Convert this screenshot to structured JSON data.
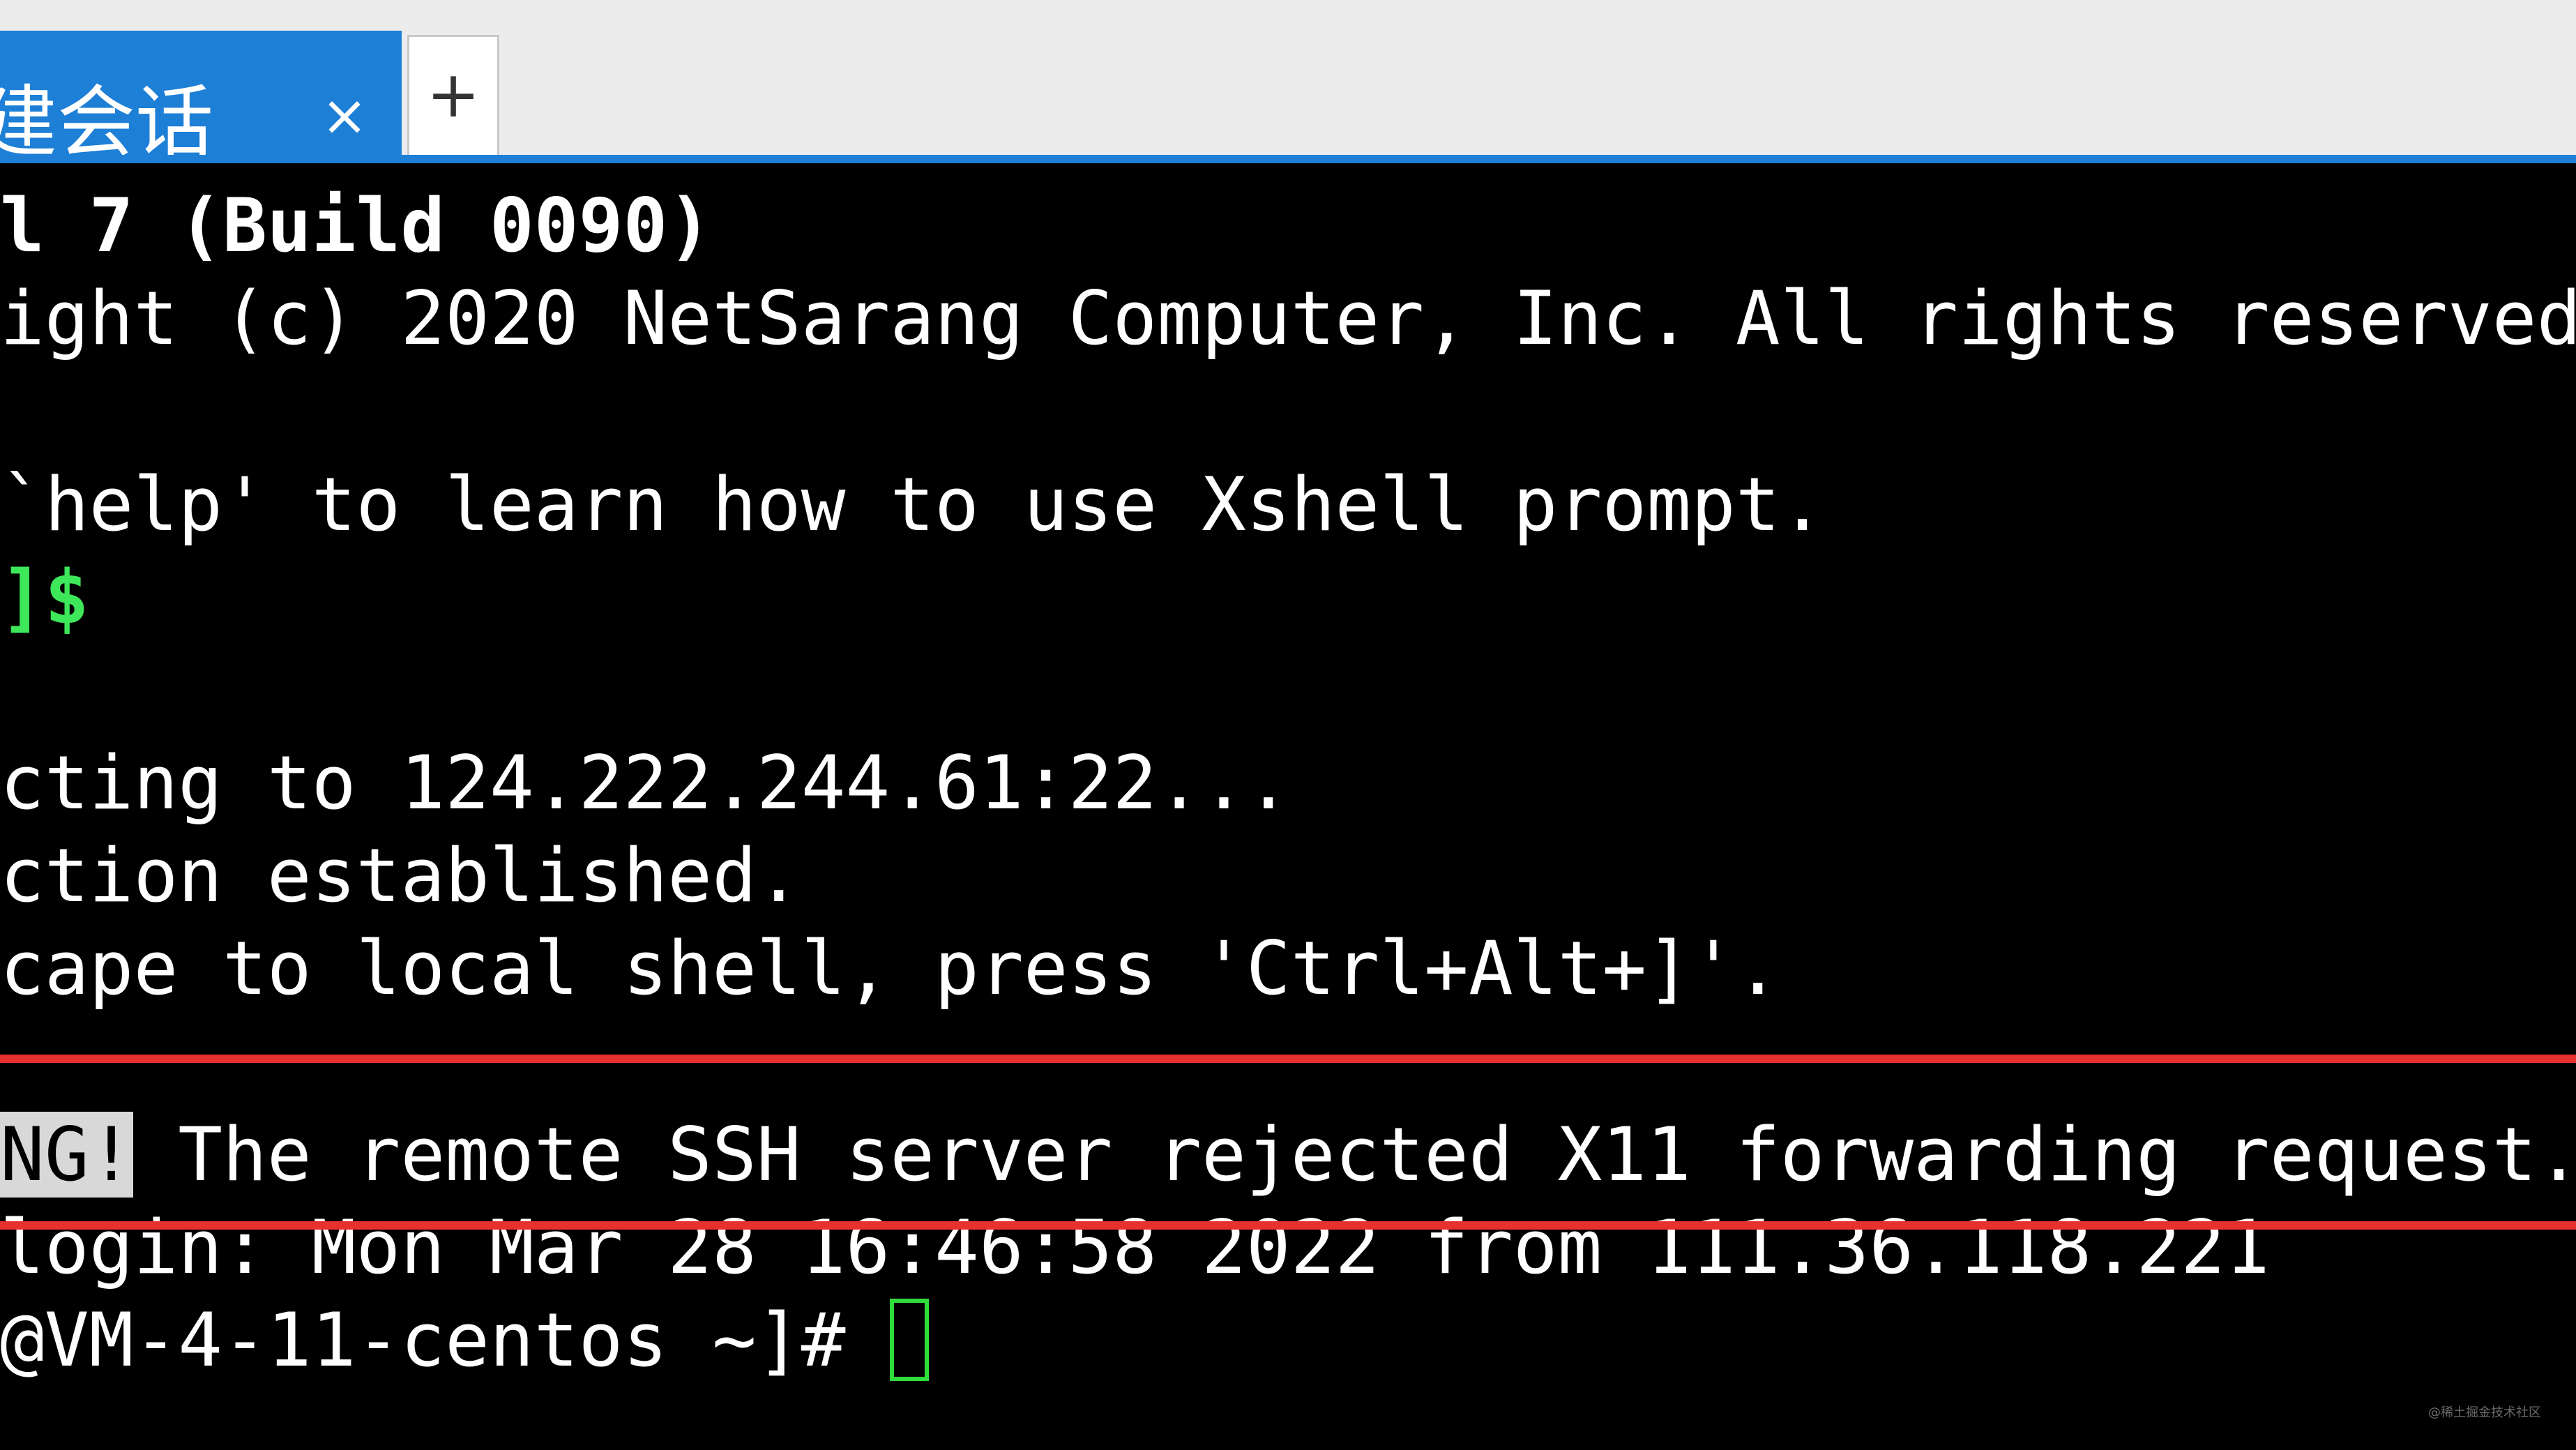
{
  "tabbar": {
    "active_tab_label": "建会话",
    "close_glyph": "×",
    "new_tab_glyph": "+"
  },
  "terminal": {
    "line_build_prefix": "l 7 (Build 0090)",
    "line_copyright": "ight (c) 2020 NetSarang Computer, Inc. All rights reserved.",
    "line_help": "`help' to learn how to use Xshell prompt.",
    "line_prompt_bracket": "]",
    "line_prompt_dollar": "$",
    "line_connecting": "cting to 124.222.244.61:22...",
    "line_established": "ction established.",
    "line_escape": "cape to local shell, press 'Ctrl+Alt+]'.",
    "warning_badge": "NG!",
    "warning_text": " The remote SSH server rejected X11 forwarding request.",
    "line_last_login": "login: Mon Mar 28 16:46:58 2022 from 111.36.118.221",
    "line_shell_prompt": "@VM-4-11-centos ~]# "
  },
  "colors": {
    "tab_accent": "#1e7fd6",
    "prompt_green": "#3ee65a",
    "highlight_red": "#e8302e",
    "terminal_bg": "#000000"
  },
  "watermark": "@稀土掘金技术社区"
}
